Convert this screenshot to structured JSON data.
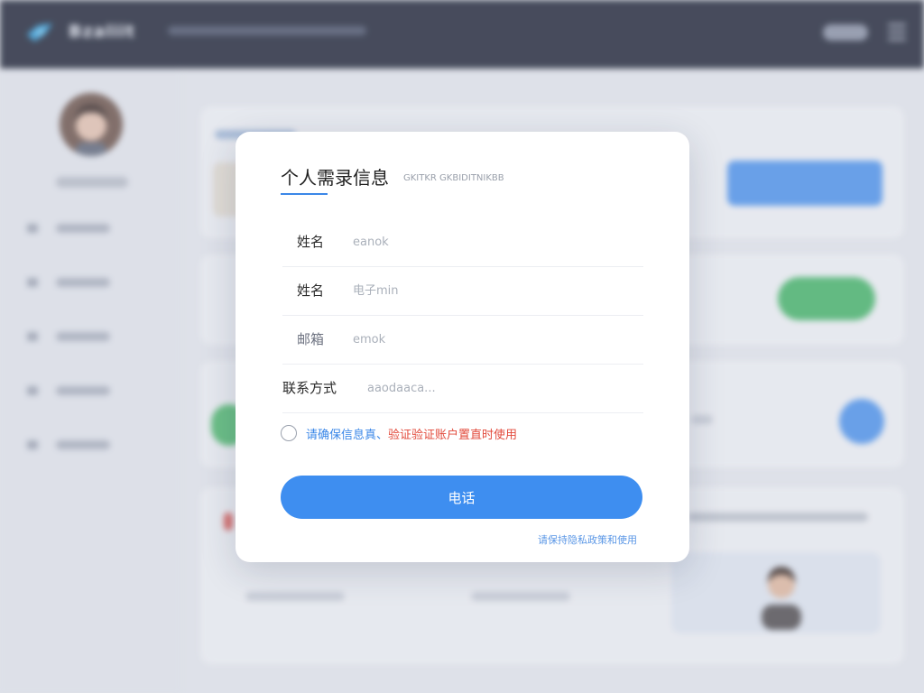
{
  "app": {
    "brand": "Bzaliit"
  },
  "modal": {
    "title": "个人需录信息",
    "subtitle": "GKITKR GKBIDITNIKBB",
    "fields": [
      {
        "label": "姓名",
        "placeholder": "eanok"
      },
      {
        "label": "姓名",
        "placeholder": "电子min"
      },
      {
        "label": "邮箱",
        "placeholder": "emok"
      },
      {
        "label": "联系方式",
        "placeholder": "aaodaaca..."
      }
    ],
    "consent": {
      "text_blue": "请确保信息真、",
      "text_red": "验证验证账户置直时使用"
    },
    "submit_label": "电话",
    "policy_link": "请保持隐私政策和使用"
  },
  "colors": {
    "accent": "#3e8ef0",
    "warning": "#e24a3b",
    "topbar": "#1c2133"
  }
}
